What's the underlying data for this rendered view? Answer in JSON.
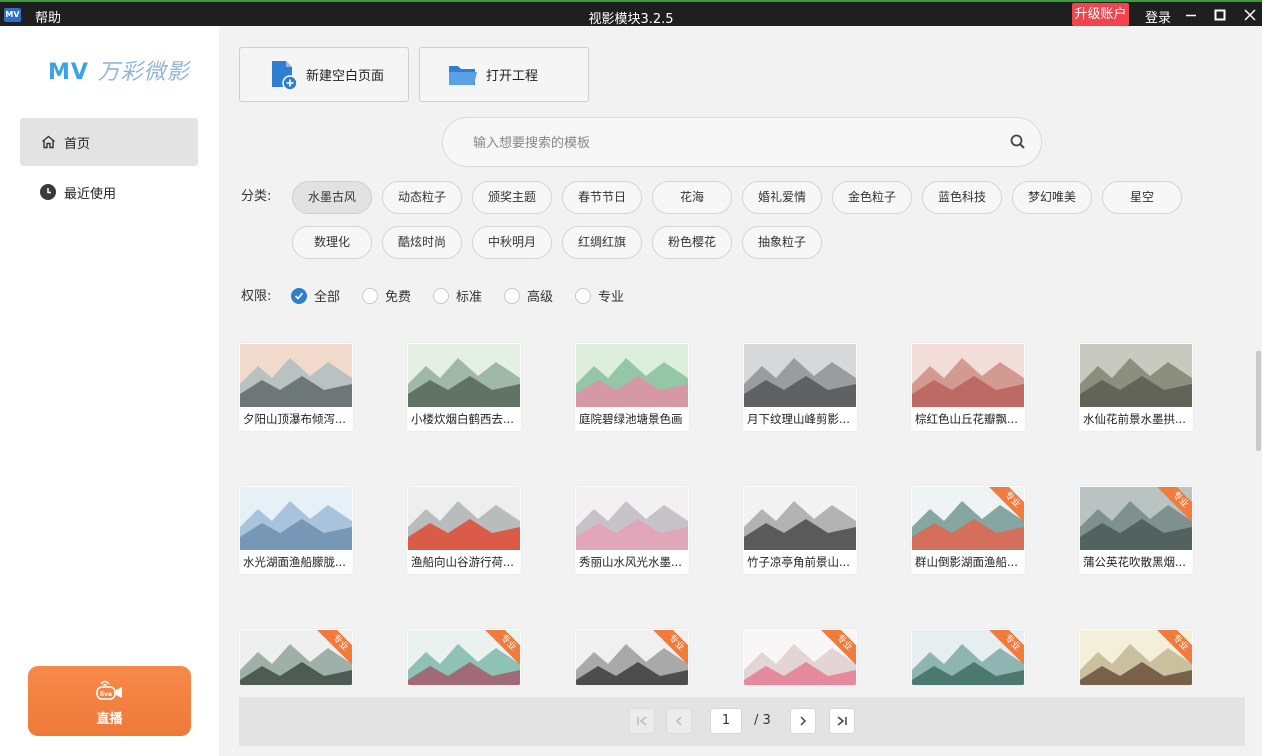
{
  "titlebar": {
    "app_icon": "MV",
    "help": "帮助",
    "title": "视影模块3.2.5",
    "upgrade": "升级账户",
    "login": "登录"
  },
  "sidebar": {
    "brand_mv": "MV",
    "brand_cn": "万彩微影",
    "items": [
      {
        "label": "首页",
        "icon": "home-icon"
      },
      {
        "label": "最近使用",
        "icon": "clock-icon"
      }
    ],
    "live_label": "直播",
    "live_icon_text": "live"
  },
  "toolbar": {
    "new_page": "新建空白页面",
    "open_project": "打开工程"
  },
  "search": {
    "placeholder": "输入想要搜索的模板"
  },
  "category": {
    "label": "分类:",
    "row1": [
      "水墨古风",
      "动态粒子",
      "颁奖主题",
      "春节节日",
      "花海",
      "婚礼爱情",
      "金色粒子",
      "蓝色科技",
      "梦幻唯美",
      "星空"
    ],
    "row2": [
      "数理化",
      "酷炫时尚",
      "中秋明月",
      "红绸红旗",
      "粉色樱花",
      "抽象粒子"
    ],
    "selected": "水墨古风"
  },
  "permission": {
    "label": "权限:",
    "options": [
      "全部",
      "免费",
      "标准",
      "高级",
      "专业"
    ],
    "selected": "全部"
  },
  "templates": {
    "pro_badge": "专业",
    "row1": [
      {
        "title": "夕阳山顶瀑布倾泻...",
        "pro": false
      },
      {
        "title": "小楼炊烟白鹤西去...",
        "pro": false
      },
      {
        "title": "庭院碧绿池塘景色画",
        "pro": false
      },
      {
        "title": "月下纹理山峰剪影...",
        "pro": false
      },
      {
        "title": "棕红色山丘花瓣飘...",
        "pro": false
      },
      {
        "title": "水仙花前景水墨拱...",
        "pro": false
      }
    ],
    "row2": [
      {
        "title": "水光湖面渔船朦胧...",
        "pro": false
      },
      {
        "title": "渔船向山谷游行荷...",
        "pro": false
      },
      {
        "title": "秀丽山水风光水墨...",
        "pro": false
      },
      {
        "title": "竹子凉亭角前景山...",
        "pro": false
      },
      {
        "title": "群山倒影湖面渔船...",
        "pro": true
      },
      {
        "title": "蒲公英花吹散黑烟...",
        "pro": true
      }
    ],
    "row3_pro": [
      true,
      true,
      true,
      true,
      true,
      true
    ]
  },
  "pagination": {
    "current": "1",
    "total": "/ 3"
  }
}
